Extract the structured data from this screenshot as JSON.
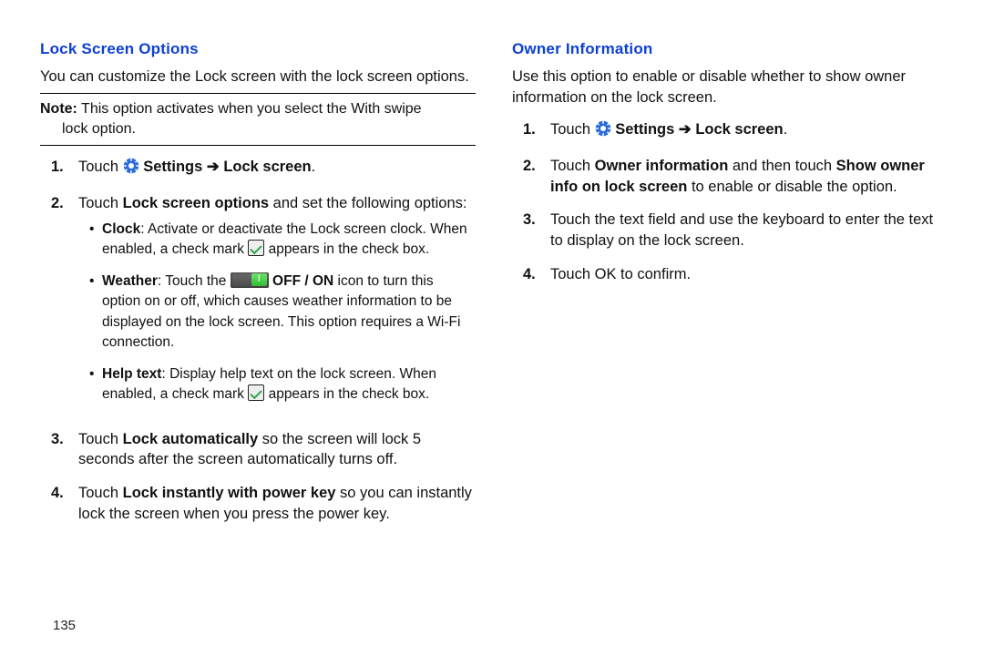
{
  "left": {
    "heading": "Lock Screen Options",
    "intro": "You can customize the Lock screen with the lock screen options.",
    "note_label": "Note:",
    "note_text1": " This option activates when you select the With swipe",
    "note_text2": "lock option.",
    "steps": [
      {
        "num": "1.",
        "pre": "Touch ",
        "bold1": "Settings",
        "arrow": " ➔ ",
        "bold2": "Lock screen",
        "tail": "."
      },
      {
        "num": "2.",
        "pre": "Touch ",
        "bold1": "Lock screen options",
        "tail": " and set the following options:"
      },
      {
        "num": "3.",
        "pre": "Touch ",
        "bold1": "Lock automatically",
        "tail": " so the screen will lock 5 seconds after the screen automatically turns off."
      },
      {
        "num": "4.",
        "pre": "Touch ",
        "bold1": "Lock instantly with power key",
        "tail": " so you can instantly lock the screen when you press the power key."
      }
    ],
    "bullets": [
      {
        "head": "Clock",
        "t1": ": Activate or deactivate the Lock screen clock. When enabled, a check mark ",
        "t2": " appears in the check box."
      },
      {
        "head": "Weather",
        "t1": ": Touch the ",
        "mid": " OFF / ON",
        "t2": " icon to turn this option on or off, which causes weather information to be displayed on the lock screen. This option requires a Wi-Fi connection."
      },
      {
        "head": "Help text",
        "t1": ": Display help text on the lock screen. When enabled, a check mark ",
        "t2": " appears in the check box."
      }
    ]
  },
  "right": {
    "heading": "Owner Information",
    "intro": "Use this option to enable or disable whether to show owner information on the lock screen.",
    "steps": [
      {
        "num": "1.",
        "pre": "Touch ",
        "bold1": "Settings",
        "arrow": " ➔ ",
        "bold2": "Lock screen",
        "tail": "."
      },
      {
        "num": "2.",
        "pre": "Touch ",
        "bold1": "Owner information",
        "mid": " and then touch ",
        "bold2": "Show owner info on lock screen",
        "tail": " to enable or disable the option."
      },
      {
        "num": "3.",
        "pre": "Touch the text field and use the keyboard to enter the text to display on the lock screen."
      },
      {
        "num": "4.",
        "pre": "Touch OK to confirm."
      }
    ]
  },
  "page_number": "135"
}
